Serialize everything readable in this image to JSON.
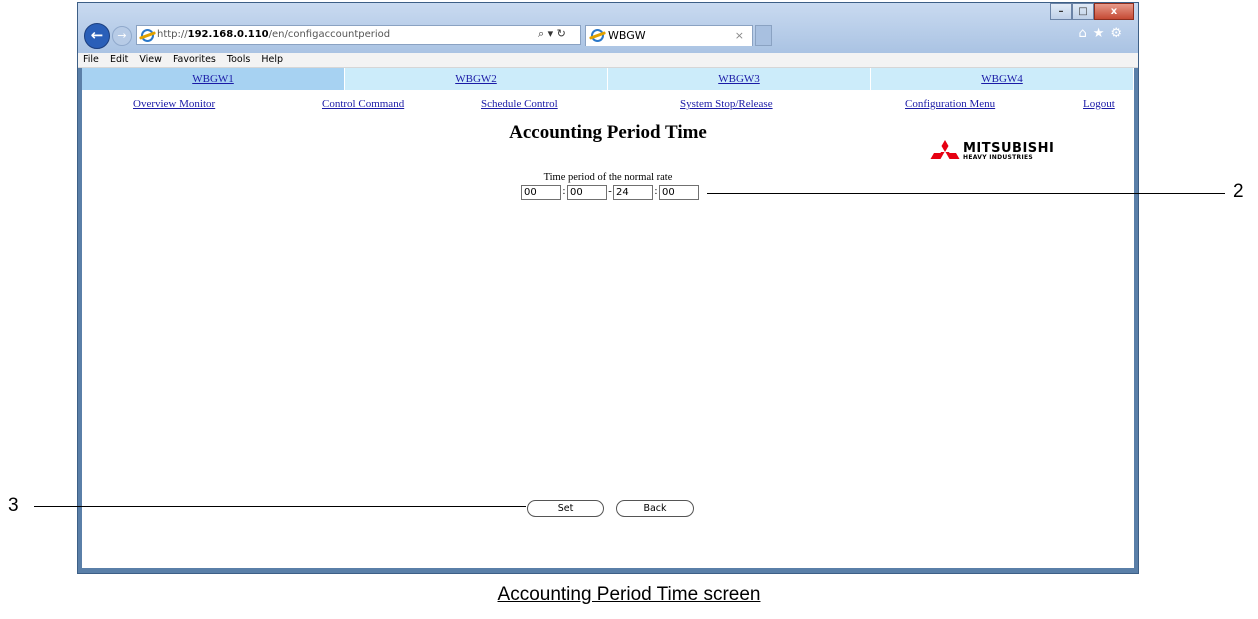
{
  "browser": {
    "url_prefix": "http://",
    "url_host": "192.168.0.110",
    "url_path": "/en/configaccountperiod",
    "search_control": "⌕ ▾ ↻",
    "tab_title": "WBGW",
    "tab_close": "×",
    "win_min": "–",
    "win_max": "□",
    "win_close": "x",
    "toolbar_icons": "⌂★⚙",
    "menu": [
      "File",
      "Edit",
      "View",
      "Favorites",
      "Tools",
      "Help"
    ]
  },
  "gateways": [
    "WBGW1",
    "WBGW2",
    "WBGW3",
    "WBGW4"
  ],
  "main_menu": {
    "overview": "Overview Monitor",
    "control": "Control Command",
    "schedule": "Schedule Control",
    "system_stop": "System Stop/Release",
    "configuration": "Configuration Menu",
    "logout": "Logout"
  },
  "page_title": "Accounting Period Time",
  "logo": {
    "line1": "MITSUBISHI",
    "line2": "HEAVY INDUSTRIES",
    "color": "#e60012"
  },
  "period": {
    "label": "Time period of the normal rate",
    "start_hour": "00",
    "start_minute": "00",
    "end_hour": "24",
    "end_minute": "00",
    "colon": ":",
    "dash": "-"
  },
  "buttons": {
    "set": "Set",
    "back": "Back"
  },
  "callouts": {
    "two": "2",
    "three": "3"
  },
  "caption": "Accounting Period Time screen"
}
